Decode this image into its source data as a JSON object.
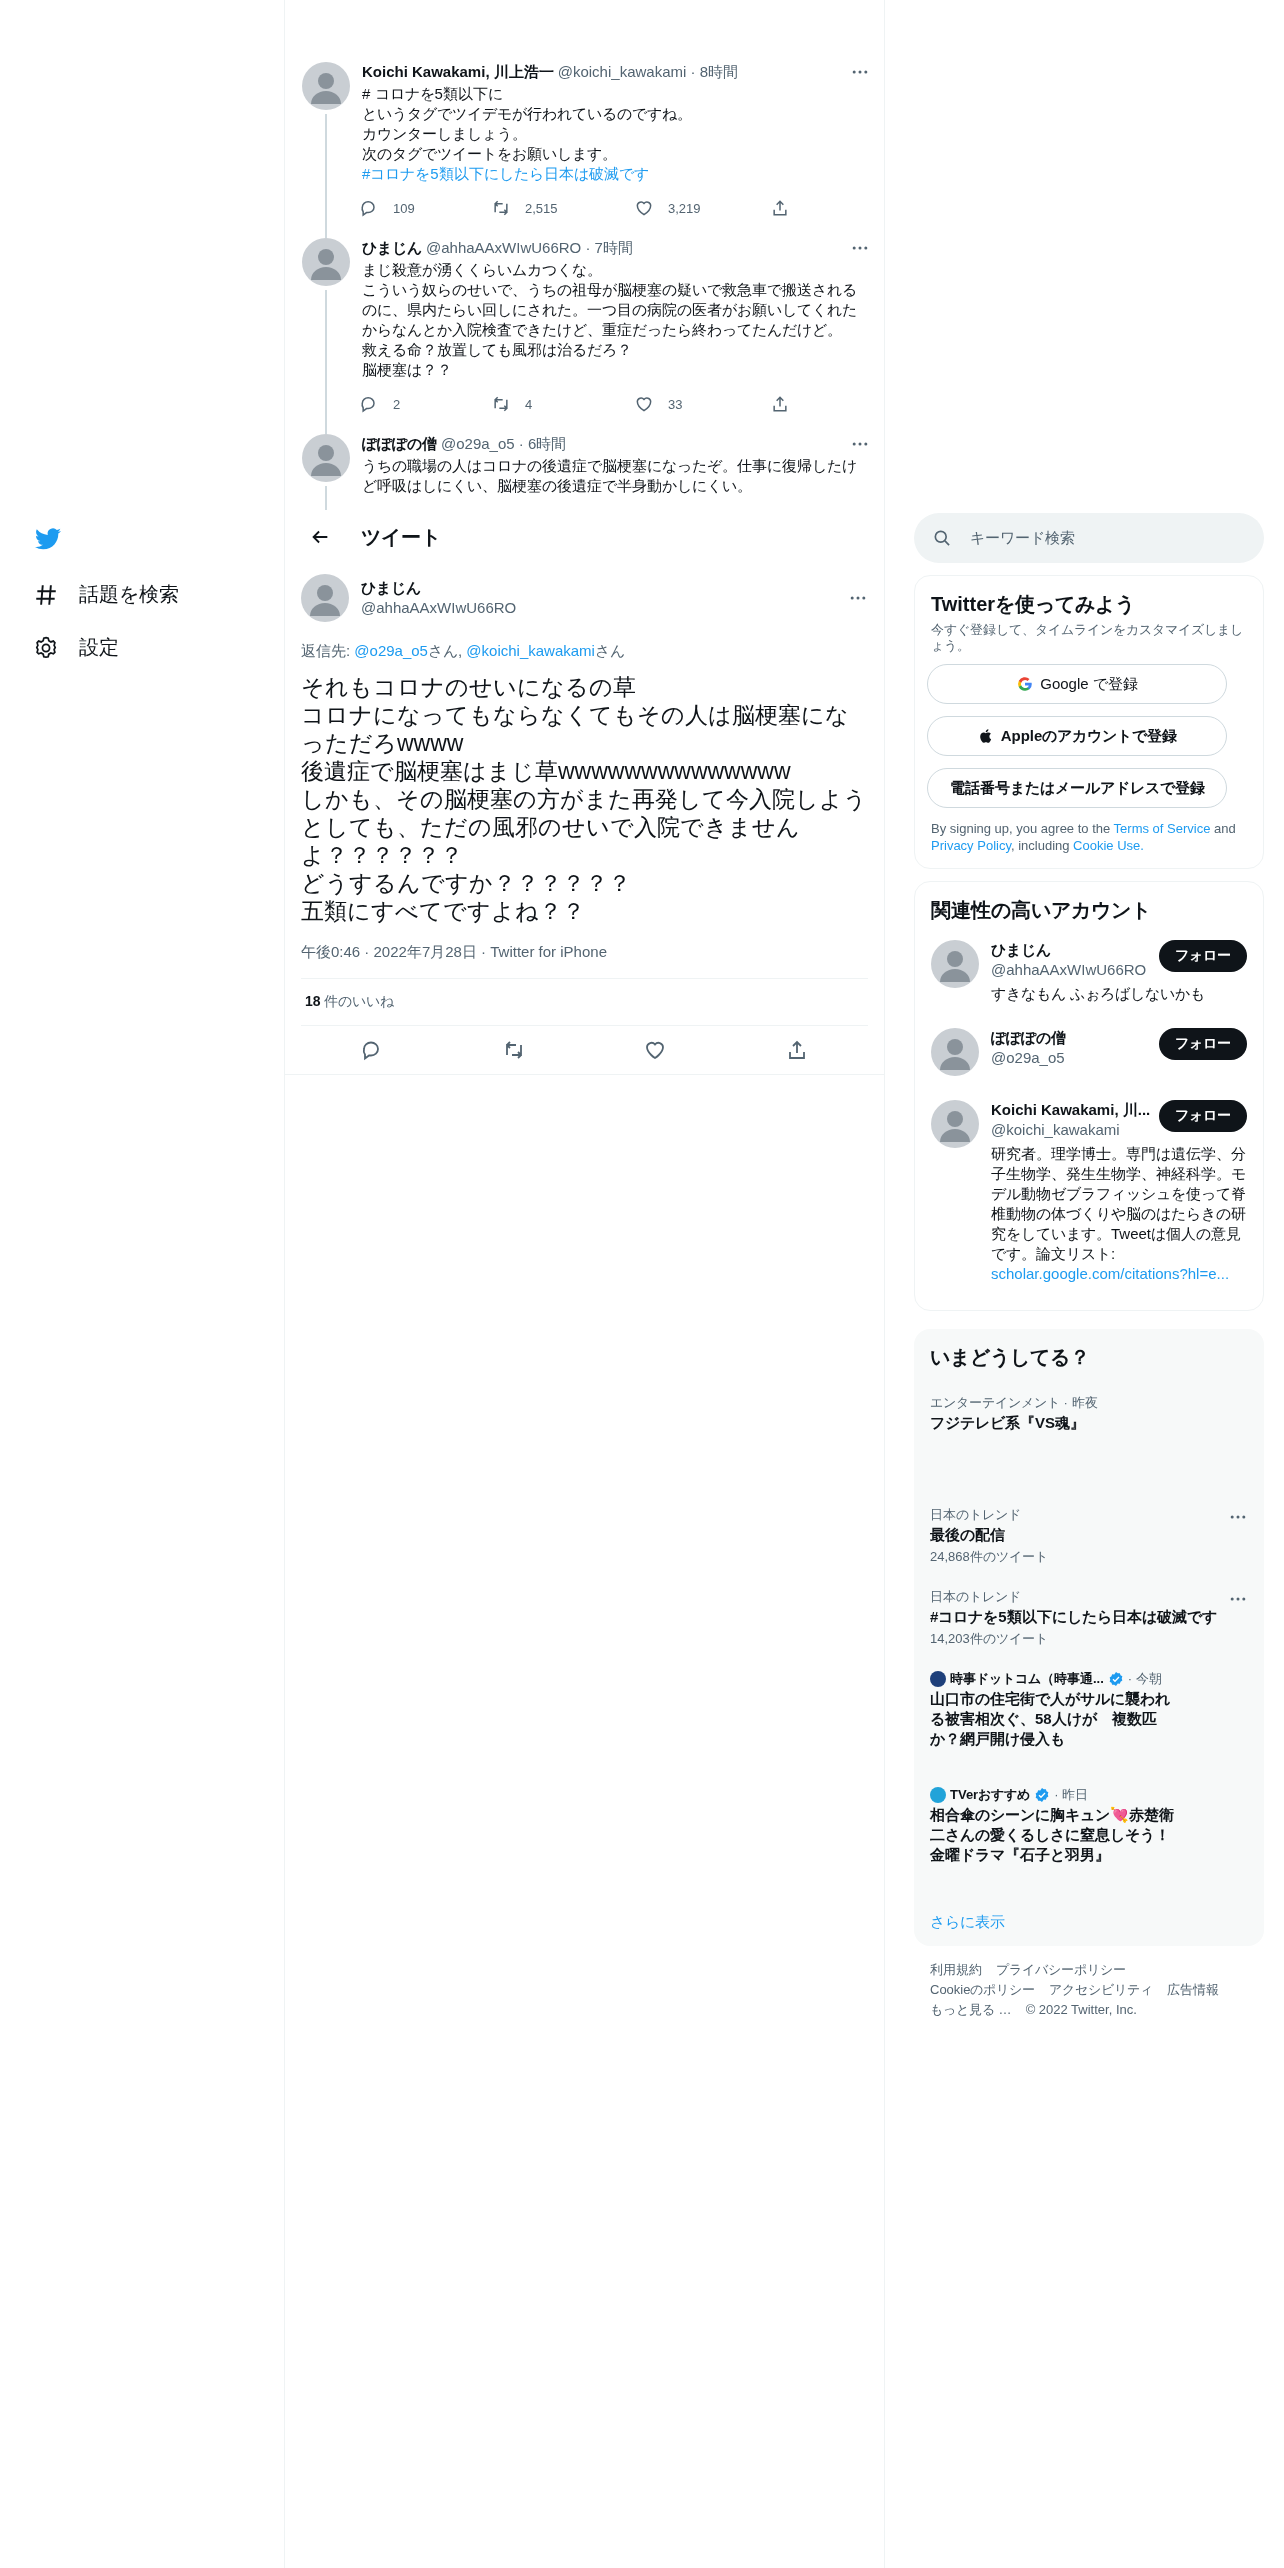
{
  "sidebar": {
    "items": [
      {
        "label": "話題を検索",
        "kind": "explore"
      },
      {
        "label": "設定",
        "kind": "settings"
      }
    ]
  },
  "thread": [
    {
      "name": "Koichi Kawakami, 川上浩一",
      "handle": "@koichi_kawakami",
      "time": "· 8時間",
      "lines": [
        "# コロナを5類以下に",
        "というタグでツイデモが行われているのですね。",
        "カウンターしましょう。",
        "次のタグでツイートをお願いします。"
      ],
      "hashtag": "#コロナを5類以下にしたら日本は破滅です",
      "stats": [
        "109",
        "2,515",
        "3,219"
      ]
    },
    {
      "name": "ひまじん",
      "handle": "@ahhaAAxWIwU66RO",
      "time": "· 7時間",
      "lines": [
        "まじ殺意が湧くくらいムカつくな。",
        "こういう奴らのせいで、うちの祖母が脳梗塞の疑いで救急車で搬送されるのに、県内たらい回しにされた。一つ目の病院の医者がお願いしてくれたからなんとか入院検査できたけど、重症だったら終わってたんだけど。",
        "救える命？放置しても風邪は治るだろ？",
        "脳梗塞は？？"
      ],
      "stats": [
        "2",
        "4",
        "33"
      ]
    },
    {
      "name": "ぽぽぽの僧",
      "handle": "@o29a_o5",
      "time": "· 6時間",
      "lines": [
        "うちの職場の人はコロナの後遺症で脳梗塞になったぞ。仕事に復帰したけど呼吸はしにくい、脳梗塞の後遺症で半身動かしにくい。"
      ]
    }
  ],
  "header": {
    "title": "ツイート"
  },
  "tweet": {
    "name": "ひまじん",
    "handle": "@ahhaAAxWIwU66RO",
    "reply_to": {
      "prefix": "返信先: ",
      "mentions": [
        {
          "handle": "@o29a_o5",
          "suffix": "さん, "
        },
        {
          "handle": "@koichi_kawakami",
          "suffix": "さん"
        }
      ]
    },
    "lines": [
      "それもコロナのせいになるの草",
      "コロナになってもならなくてもその人は脳梗塞になっただろwwww",
      "後遺症で脳梗塞はまじ草wwwwwwwwwwwwww",
      "しかも、その脳梗塞の方がまた再発して今入院しようとしても、ただの風邪のせいで入院できませんよ？？？？？？",
      "どうするんですか？？？？？？",
      "五類にすべてですよね？？"
    ],
    "meta": "午後0:46 · 2022年7月28日 · Twitter for iPhone",
    "likes": {
      "count": "18",
      "label": "件のいいね"
    }
  },
  "search": {
    "placeholder": "キーワード検索"
  },
  "signup": {
    "title": "Twitterを使ってみよう",
    "subtitle": "今すぐ登録して、タイムラインをカスタマイズしましょう。",
    "buttons": [
      {
        "label": "Google で登録",
        "kind": "google"
      },
      {
        "label": "Appleのアカウントで登録",
        "kind": "apple"
      },
      {
        "label": "電話番号またはメールアドレスで登録",
        "kind": "plain"
      }
    ],
    "terms": [
      {
        "text": "By signing up, you agree to the ",
        "link": false
      },
      {
        "text": "Terms of Service",
        "link": true
      },
      {
        "text": " and ",
        "link": false
      },
      {
        "text": "Privacy Policy",
        "link": true
      },
      {
        "text": ", including ",
        "link": false
      },
      {
        "text": "Cookie Use.",
        "link": true
      }
    ]
  },
  "accounts": {
    "title": "関連性の高いアカウント",
    "items": [
      {
        "name": "ひまじん",
        "handle": "@ahhaAAxWIwU66RO",
        "button": "フォロー",
        "bio": "すきなもん ふぉろばしないかも"
      },
      {
        "name": "ぽぽぽの僧",
        "handle": "@o29a_o5",
        "button": "フォロー"
      },
      {
        "name": "Koichi Kawakami, 川...",
        "handle": "@koichi_kawakami",
        "button": "フォロー",
        "bio": "研究者。理学博士。専門は遺伝学、分子生物学、発生生物学、神経科学。モデル動物ゼブラフィッシュを使って脊椎動物の体づくりや脳のはたらきの研究をしています。Tweetは個人の意見です。論文リスト: ",
        "bio_link": "scholar.google.com/citations?hl=e..."
      }
    ]
  },
  "trends": {
    "title": "いまどうしてる？",
    "more": "さらに表示",
    "items": [
      {
        "kind": "topic",
        "category": "エンターテインメント · 昨夜",
        "title": "フジテレビ系『VS魂』"
      },
      {
        "kind": "trend",
        "category": "日本のトレンド",
        "title": "最後の配信",
        "count": "24,868件のツイート"
      },
      {
        "kind": "trend",
        "category": "日本のトレンド",
        "title": "#コロナを5類以下にしたら日本は破滅です",
        "count": "14,203件のツイート"
      },
      {
        "kind": "news",
        "source": "時事ドットコム（時事通...",
        "verified": true,
        "time": "· 今朝",
        "title": "山口市の住宅街で人がサルに襲われる被害相次ぐ、58人けが　複数匹か？網戸開け侵入も",
        "color": "#1d3f7a"
      },
      {
        "kind": "news",
        "source": "TVerおすすめ",
        "verified": true,
        "time": "· 昨日",
        "title": "相合傘のシーンに胸キュン💘赤楚衛二さんの愛くるしさに窒息しそう！金曜ドラマ『石子と羽男』",
        "color": "#21a3d9"
      }
    ]
  },
  "footer": {
    "rows": [
      [
        "利用規約",
        "プライバシーポリシー"
      ],
      [
        "Cookieのポリシー",
        "アクセシビリティ",
        "広告情報"
      ],
      [
        "もっと見る …"
      ]
    ],
    "copyright": "© 2022 Twitter, Inc."
  }
}
